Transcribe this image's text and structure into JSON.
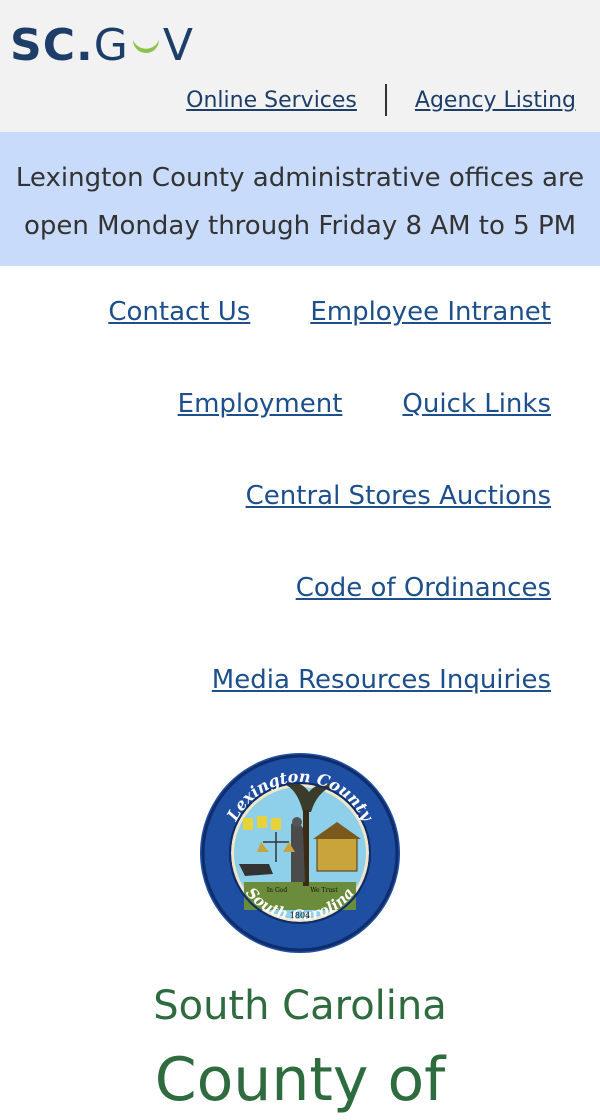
{
  "header": {
    "logo_text_sc": "SC",
    "logo_text_dot": ".",
    "logo_text_g": "G",
    "logo_text_v": "V",
    "links": [
      {
        "label": "Online Services"
      },
      {
        "label": "Agency Listing"
      }
    ]
  },
  "notice": {
    "line1": "Lexington County administrative offices are",
    "line2": "open Monday through Friday 8 AM to 5 PM"
  },
  "nav": {
    "contact": "Contact Us",
    "intranet": "Employee Intranet",
    "employment": "Employment",
    "quick_links": "Quick Links",
    "auctions": "Central Stores Auctions",
    "ordinances": "Code of Ordinances",
    "media": "Media Resources Inquiries"
  },
  "seal": {
    "top_text": "Lexington County",
    "bottom_text": "South Carolina",
    "motto_left": "In God",
    "motto_right": "We Trust",
    "year": "1804"
  },
  "title": {
    "state": "South Carolina",
    "county_partial": "County of"
  },
  "colors": {
    "brand_navy": "#1d3e68",
    "link_blue": "#1d4f8c",
    "notice_bg": "#c9dbfb",
    "title_green": "#2e6b3f",
    "moon_green": "#8bc34a"
  }
}
